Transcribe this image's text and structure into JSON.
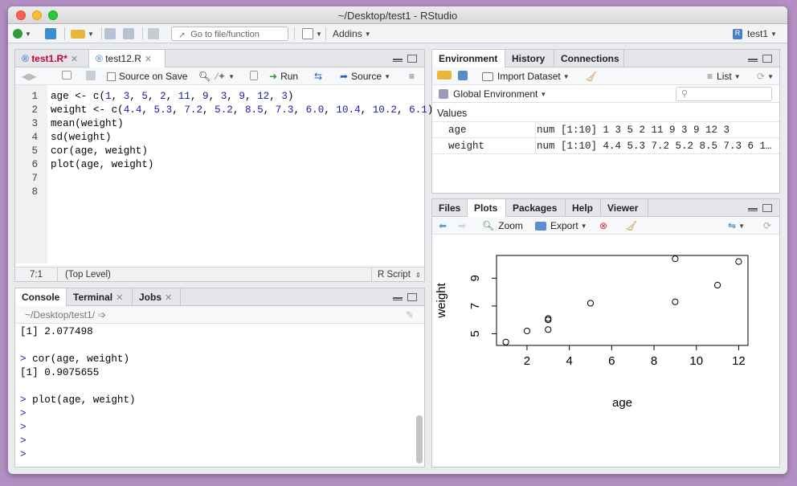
{
  "window": {
    "title": "~/Desktop/test1 - RStudio"
  },
  "toolbar": {
    "goto_placeholder": "Go to file/function",
    "addins_label": "Addins",
    "project_label": "test1"
  },
  "editor": {
    "tabs": [
      {
        "label": "test1.R*"
      },
      {
        "label": "test12.R"
      }
    ],
    "source_on_save_label": "Source on Save",
    "run_label": "Run",
    "source_label": "Source",
    "line_numbers": [
      "1",
      "2",
      "3",
      "4",
      "5",
      "6",
      "7",
      "8"
    ],
    "lines": [
      "age <- c(1, 3, 5, 2, 11, 9, 3, 9, 12, 3)",
      "weight <- c(4.4, 5.3, 7.2, 5.2, 8.5, 7.3, 6.0, 10.4, 10.2, 6.1)",
      "mean(weight)",
      "sd(weight)",
      "cor(age, weight)",
      "plot(age, weight)",
      "",
      ""
    ],
    "status": {
      "position": "7:1",
      "scope": "(Top Level)",
      "type": "R Script"
    }
  },
  "console": {
    "tabs": [
      {
        "label": "Console"
      },
      {
        "label": "Terminal"
      },
      {
        "label": "Jobs"
      }
    ],
    "path": "~/Desktop/test1/",
    "lines": [
      {
        "text": "[1] 2.077498",
        "kind": "output"
      },
      {
        "text": "",
        "kind": "blank"
      },
      {
        "text": "> cor(age, weight)",
        "kind": "cmd"
      },
      {
        "text": "[1] 0.9075655",
        "kind": "output"
      },
      {
        "text": "",
        "kind": "blank"
      },
      {
        "text": "> plot(age, weight)",
        "kind": "cmd"
      },
      {
        "text": ">",
        "kind": "prompt"
      },
      {
        "text": ">",
        "kind": "prompt"
      },
      {
        "text": ">",
        "kind": "prompt"
      },
      {
        "text": ">",
        "kind": "prompt"
      }
    ]
  },
  "environment": {
    "tabs": [
      {
        "label": "Environment"
      },
      {
        "label": "History"
      },
      {
        "label": "Connections"
      }
    ],
    "import_label": "Import Dataset",
    "list_label": "List",
    "scope_label": "Global Environment",
    "section_label": "Values",
    "rows": [
      {
        "name": "age",
        "value": "num [1:10] 1 3 5 2 11 9 3 9 12 3"
      },
      {
        "name": "weight",
        "value": "num [1:10] 4.4 5.3 7.2 5.2 8.5 7.3 6 1…"
      }
    ]
  },
  "files": {
    "tabs": [
      {
        "label": "Files"
      },
      {
        "label": "Plots"
      },
      {
        "label": "Packages"
      },
      {
        "label": "Help"
      },
      {
        "label": "Viewer"
      }
    ],
    "zoom_label": "Zoom",
    "export_label": "Export"
  },
  "chart_data": {
    "type": "scatter",
    "xlabel": "age",
    "ylabel": "weight",
    "x": [
      1,
      3,
      5,
      2,
      11,
      9,
      3,
      9,
      12,
      3
    ],
    "y": [
      4.4,
      5.3,
      7.2,
      5.2,
      8.5,
      7.3,
      6.0,
      10.4,
      10.2,
      6.1
    ],
    "xticks": [
      2,
      4,
      6,
      8,
      10,
      12
    ],
    "yticks": [
      5,
      7,
      9
    ],
    "xlim": [
      0.56,
      12.44
    ],
    "ylim": [
      4.16,
      10.64
    ]
  }
}
